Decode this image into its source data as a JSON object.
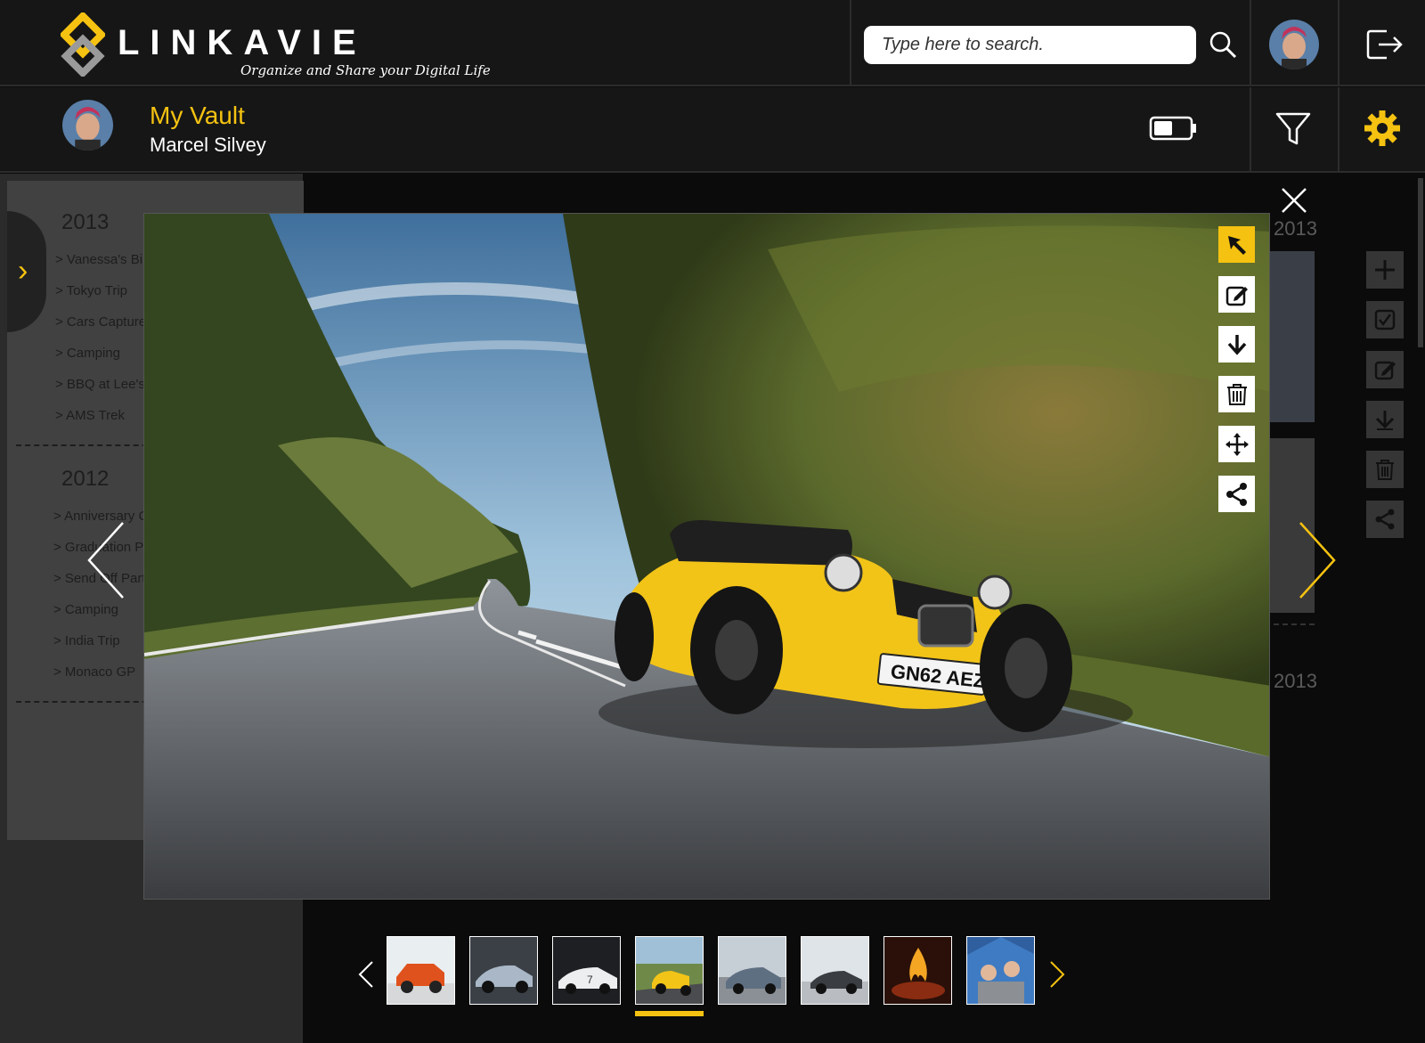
{
  "header": {
    "logo_text": "LINKAVIE",
    "logo_tagline": "Organize and Share your Digital Life",
    "search_placeholder": "Type here to search."
  },
  "subheader": {
    "title": "My Vault",
    "user_name": "Marcel Silvey"
  },
  "sidebar": {
    "groups": [
      {
        "year": "2013",
        "albums": [
          "> Vanessa's Birthday",
          "> Tokyo Trip",
          "> Cars Captured",
          "> Camping",
          "> BBQ at Lee's",
          "> AMS Trek"
        ]
      },
      {
        "year": "2012",
        "albums": [
          "> Anniversary Celebration",
          "> Graduation Party",
          "> Send Off Party",
          "> Camping",
          "> India Trip",
          "> Monaco GP"
        ]
      }
    ]
  },
  "background_gallery": {
    "year_labels": [
      "2013",
      "2013"
    ]
  },
  "viewer": {
    "license_plate": "GN62 AEZ",
    "tools": [
      "select-icon",
      "edit-icon",
      "download-icon",
      "delete-icon",
      "move-icon",
      "share-icon"
    ],
    "active_tool": "select-icon"
  },
  "side_tools": [
    "plus-icon",
    "check-icon",
    "edit-icon",
    "download-icon",
    "delete-icon",
    "share-icon"
  ],
  "filmstrip": {
    "thumbnails": [
      "orange-suv",
      "silver-sports-car",
      "white-race-car",
      "yellow-caterham",
      "silver-supercar",
      "dark-coupe",
      "campfire",
      "family-camping"
    ],
    "selected_index": 3
  },
  "colors": {
    "accent": "#f5c211",
    "header_bg": "#161616",
    "panel_bg": "#2b2b2b",
    "sidebar_bg": "#414141"
  }
}
